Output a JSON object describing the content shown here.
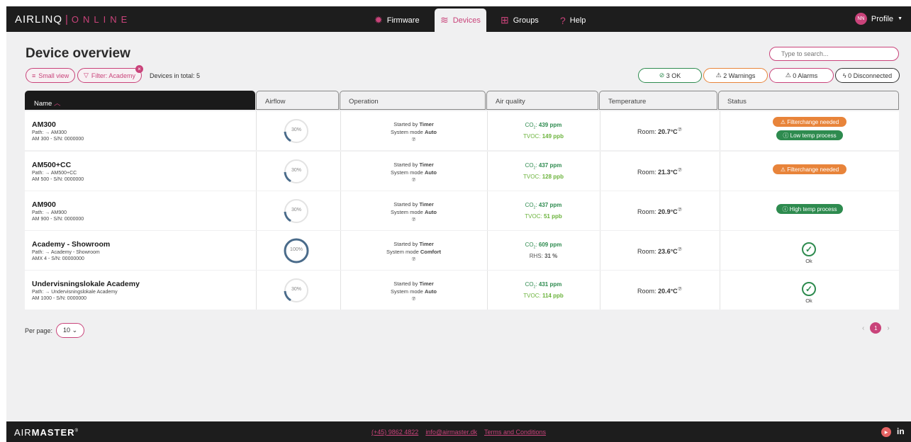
{
  "app": {
    "brand": "AIRLINQ",
    "brand_sub": "ONLINE",
    "nav": [
      {
        "label": "Firmware",
        "icon": "gear-icon"
      },
      {
        "label": "Devices",
        "icon": "devices-icon"
      },
      {
        "label": "Groups",
        "icon": "groups-icon"
      },
      {
        "label": "Help",
        "icon": "help-icon"
      }
    ],
    "profile": {
      "initials": "NN",
      "label": "Profile"
    }
  },
  "page": {
    "title": "Device overview",
    "search_placeholder": "Type to search...",
    "small_view_label": "Small view",
    "filter_label": "Filter: Academy",
    "devices_total": "Devices in total: 5",
    "stats": {
      "ok": "3 OK",
      "warnings": "2 Warnings",
      "alarms": "0 Alarms",
      "disconnected": "0 Disconnected"
    }
  },
  "columns": [
    "Name",
    "Airflow",
    "Operation",
    "Air quality",
    "Temperature",
    "Status"
  ],
  "devices": [
    {
      "name": "AM300",
      "path": "Path: → AM300",
      "sn": "AM 300 - S/N: 0000000",
      "airflow": "30%",
      "airflow_level": 30,
      "op_started": "Started by",
      "op_started_val": "Timer",
      "op_mode": "System mode",
      "op_mode_val": "Auto",
      "aq1_label": "CO",
      "aq1_val": "439 ppm",
      "aq2_label": "TVOC:",
      "aq2_val": "149 ppb",
      "temp_label": "Room:",
      "temp_val": "20.7°C",
      "status": [
        "Filterchange needed",
        "Low temp process"
      ]
    },
    {
      "name": "AM500+CC",
      "path": "Path: → AM500+CC",
      "sn": "AM 500 - S/N: 0000000",
      "airflow": "30%",
      "airflow_level": 30,
      "op_started": "Started by",
      "op_started_val": "Timer",
      "op_mode": "System mode",
      "op_mode_val": "Auto",
      "aq1_label": "CO",
      "aq1_val": "437 ppm",
      "aq2_label": "TVOC:",
      "aq2_val": "128 ppb",
      "temp_label": "Room:",
      "temp_val": "21.3°C",
      "status": [
        "Filterchange needed"
      ]
    },
    {
      "name": "AM900",
      "path": "Path: → AM900",
      "sn": "AM 900 - S/N: 0000000",
      "airflow": "30%",
      "airflow_level": 30,
      "op_started": "Started by",
      "op_started_val": "Timer",
      "op_mode": "System mode",
      "op_mode_val": "Auto",
      "aq1_label": "CO",
      "aq1_val": "437 ppm",
      "aq2_label": "TVOC:",
      "aq2_val": "51 ppb",
      "temp_label": "Room:",
      "temp_val": "20.9°C",
      "status": [
        "High temp process"
      ]
    },
    {
      "name": "Academy - Showroom",
      "path": "Path: → Academy - Showroom",
      "sn": "AMX 4 - S/N: 00000000",
      "airflow": "100%",
      "airflow_level": 100,
      "op_started": "Started by",
      "op_started_val": "Timer",
      "op_mode": "System mode",
      "op_mode_val": "Comfort",
      "aq1_label": "CO",
      "aq1_val": "609 ppm",
      "aq2_label": "RHS:",
      "aq2_val": "31 %",
      "temp_label": "Room:",
      "temp_val": "23.6°C",
      "status": [
        "Ok"
      ]
    },
    {
      "name": "Undervisningslokale Academy",
      "path": "Path: → Undervisningslokale Academy",
      "sn": "AM 1000 - S/N: 0000000",
      "airflow": "30%",
      "airflow_level": 30,
      "op_started": "Started by",
      "op_started_val": "Timer",
      "op_mode": "System mode",
      "op_mode_val": "Auto",
      "aq1_label": "CO",
      "aq1_val": "431 ppm",
      "aq2_label": "TVOC:",
      "aq2_val": "114 ppb",
      "temp_label": "Room:",
      "temp_val": "20.4°C",
      "status": [
        "Ok"
      ]
    }
  ],
  "pagination": {
    "per_page_label": "Per page:",
    "per_page_value": "10",
    "current_page": "1"
  },
  "footer": {
    "logo_light": "AIR",
    "logo_bold": "MASTER",
    "logo_mark": "®",
    "phone": "(+45) 9862 4822",
    "email": "info@airmaster.dk",
    "terms": "Terms and Conditions",
    "linkedin": "in"
  },
  "colors": {
    "accent": "#c9437a",
    "dark": "#1d1d1d",
    "ok_green": "#2e8b4f",
    "warning_orange": "#e8843a",
    "aq_green": "#2e8b4f",
    "aq_light": "#6bb33c"
  }
}
